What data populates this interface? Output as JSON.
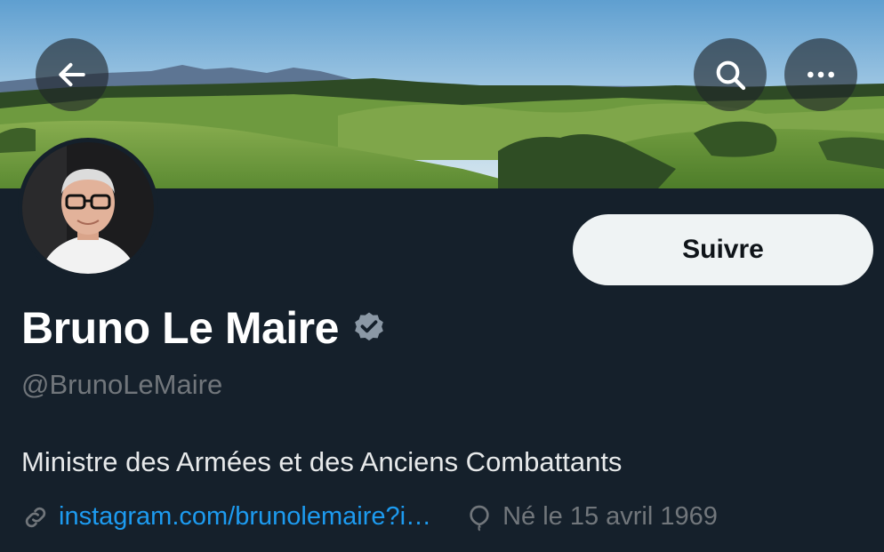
{
  "header": {
    "back_icon": "arrow-left-icon",
    "search_icon": "search-icon",
    "more_icon": "more-horizontal-icon"
  },
  "profile": {
    "name": "Bruno Le Maire",
    "verified": true,
    "verified_color": "#8b98a5",
    "handle": "@BrunoLeMaire",
    "bio": "Ministre des Armées et des Anciens Combattants",
    "link_text": "instagram.com/brunolemaire?i…",
    "link_icon": "link-icon",
    "birth_text": "Né le 15 avril 1969",
    "birth_icon": "balloon-icon"
  },
  "actions": {
    "follow_label": "Suivre"
  },
  "colors": {
    "background": "#15202b",
    "link": "#1d9bf0",
    "muted": "#71767b",
    "button_bg": "#eff3f4"
  }
}
